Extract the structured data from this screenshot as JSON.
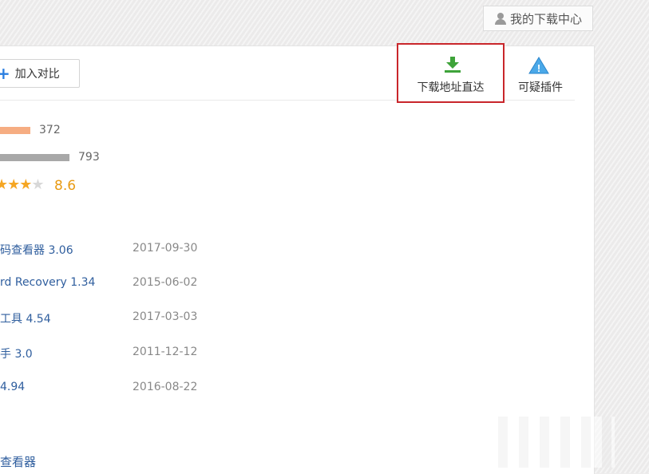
{
  "header": {
    "my_downloads_label": "我的下载中心"
  },
  "toolbar": {
    "compare_label": "加入对比"
  },
  "actions": {
    "download_direct_label": "下载地址直达",
    "suspicious_plugin_label": "可疑插件"
  },
  "stats": {
    "bar1_value": "372",
    "bar2_value": "793",
    "rating": "8.6"
  },
  "related": [
    {
      "name": "码查看器 3.06",
      "date": "2017-09-30"
    },
    {
      "name": "rd Recovery 1.34",
      "date": "2015-06-02"
    },
    {
      "name": "工具 4.54",
      "date": "2017-03-03"
    },
    {
      "name": "手 3.0",
      "date": "2011-12-12"
    },
    {
      "name": "4.94",
      "date": "2016-08-22"
    }
  ],
  "footer": {
    "link_label": "查看器"
  },
  "colors": {
    "highlight_border": "#c9262b",
    "download_green": "#3ea33a",
    "link_blue": "#2f5e9e",
    "star_orange": "#f5a623"
  }
}
